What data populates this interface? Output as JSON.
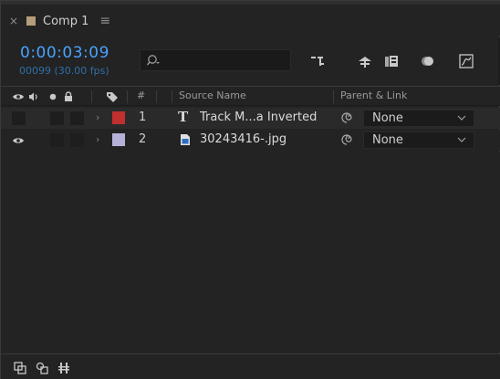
{
  "tab": {
    "close_glyph": "×",
    "label": "Comp 1",
    "menu_glyph": "≡",
    "swatch_color": "#b59d7a"
  },
  "timecode": {
    "value": "0:00:03:09",
    "frames": "00099 (30.00 fps)",
    "color": "#49a3ff"
  },
  "search": {
    "value": "",
    "placeholder": ""
  },
  "toolbar_icons": [
    "comp-flowchart-icon",
    "draft-3d-icon",
    "frame-blending-icon",
    "motion-blur-icon",
    "graph-editor-icon"
  ],
  "columns": {
    "number": "#",
    "source_name": "Source Name",
    "parent_link": "Parent & Link"
  },
  "layers": [
    {
      "number": "1",
      "type_glyph": "T",
      "name": "Track M...a Inverted",
      "label_color": "#c0302f",
      "parent": "None",
      "visible": false
    },
    {
      "number": "2",
      "type_glyph": "image",
      "name": "30243416-.jpg",
      "label_color": "#b6b1d6",
      "parent": "None",
      "visible": true
    }
  ],
  "bottom_icons": [
    "toggle-layer-switches-icon",
    "toggle-transfer-controls-icon",
    "toggle-in-out-icon"
  ]
}
